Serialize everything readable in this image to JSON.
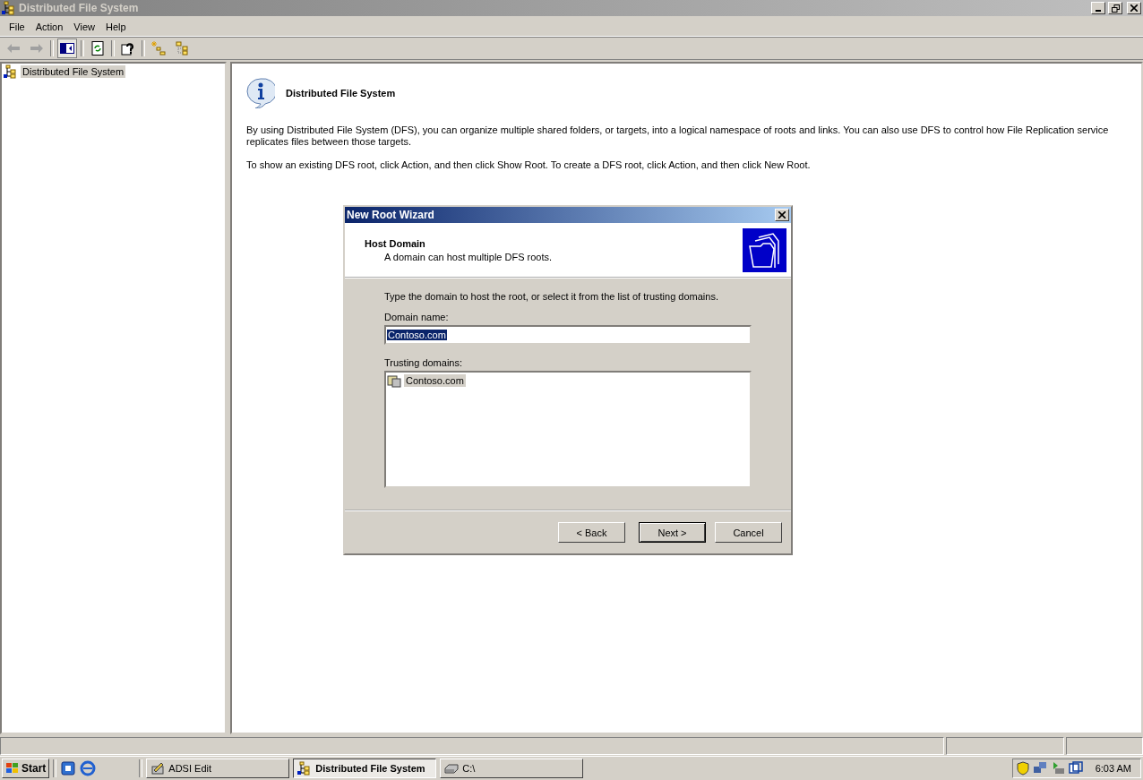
{
  "window": {
    "title": "Distributed File System",
    "active": false
  },
  "menu": [
    {
      "label": "File"
    },
    {
      "label": "Action"
    },
    {
      "label": "View"
    },
    {
      "label": "Help"
    }
  ],
  "tree": {
    "items": [
      {
        "label": "Distributed File System",
        "selected": true
      }
    ]
  },
  "info": {
    "heading": "Distributed File System",
    "paragraphs": [
      "By using Distributed File System (DFS), you can organize multiple shared folders, or targets, into a logical namespace of roots and links. You can also use DFS to control how File Replication service replicates files between those targets.",
      "To show an existing DFS root, click Action, and then click Show Root. To create a DFS root, click Action, and then click New Root."
    ]
  },
  "dialog": {
    "title": "New Root Wizard",
    "header_title": "Host Domain",
    "header_subtitle": "A domain can host multiple DFS roots.",
    "instruction": "Type the domain to host the root, or select it from the list of trusting domains.",
    "domain_label": "Domain name:",
    "domain_value": "Contoso.com",
    "trusting_label": "Trusting domains:",
    "trusting_domains": [
      {
        "label": "Contoso.com",
        "selected": true
      }
    ],
    "buttons": [
      {
        "label": "< Back",
        "default": false
      },
      {
        "label": "Next >",
        "default": true
      },
      {
        "label": "Cancel",
        "default": false
      }
    ]
  },
  "taskbar": {
    "start": "Start",
    "tasks": [
      {
        "label": "ADSI Edit",
        "active": false,
        "kind": "adsi"
      },
      {
        "label": "Distributed File System",
        "active": true,
        "kind": "dfs"
      },
      {
        "label": "C:\\",
        "active": false,
        "kind": "drive"
      }
    ],
    "clock": "6:03 AM"
  }
}
